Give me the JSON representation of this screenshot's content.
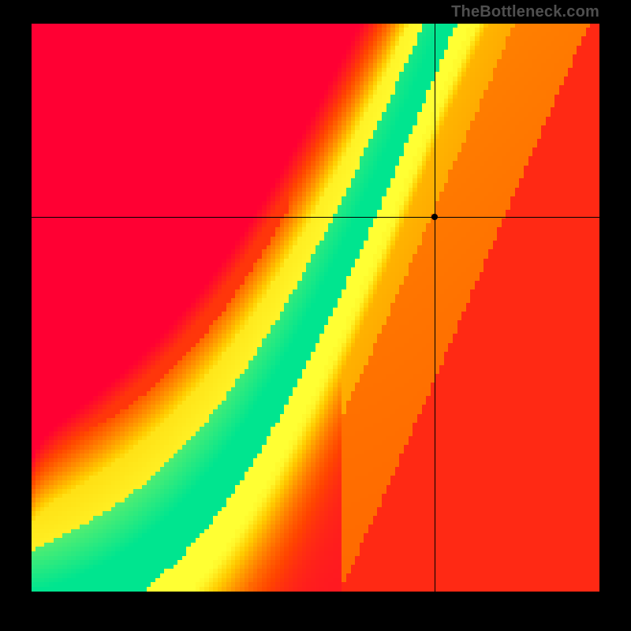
{
  "attribution": "TheBottleneck.com",
  "chart_data": {
    "type": "heatmap",
    "title": "",
    "xlabel": "",
    "ylabel": "",
    "xlim": [
      0,
      1
    ],
    "ylim": [
      0,
      1
    ],
    "grid": false,
    "legend": false,
    "color_scale": [
      "#ff0033",
      "#ff4400",
      "#ff8800",
      "#ffcc00",
      "#ffff33",
      "#00e58f"
    ],
    "ridge_params": {
      "a": 2.3,
      "b": 5.0,
      "falloff_scale": 0.22,
      "falloff_power": 0.9,
      "corner_boost": 0.18,
      "pixelation": 128
    },
    "crosshair": {
      "x": 0.71,
      "y": 0.66
    },
    "marker": {
      "x": 0.71,
      "y": 0.66
    },
    "annotations": []
  }
}
